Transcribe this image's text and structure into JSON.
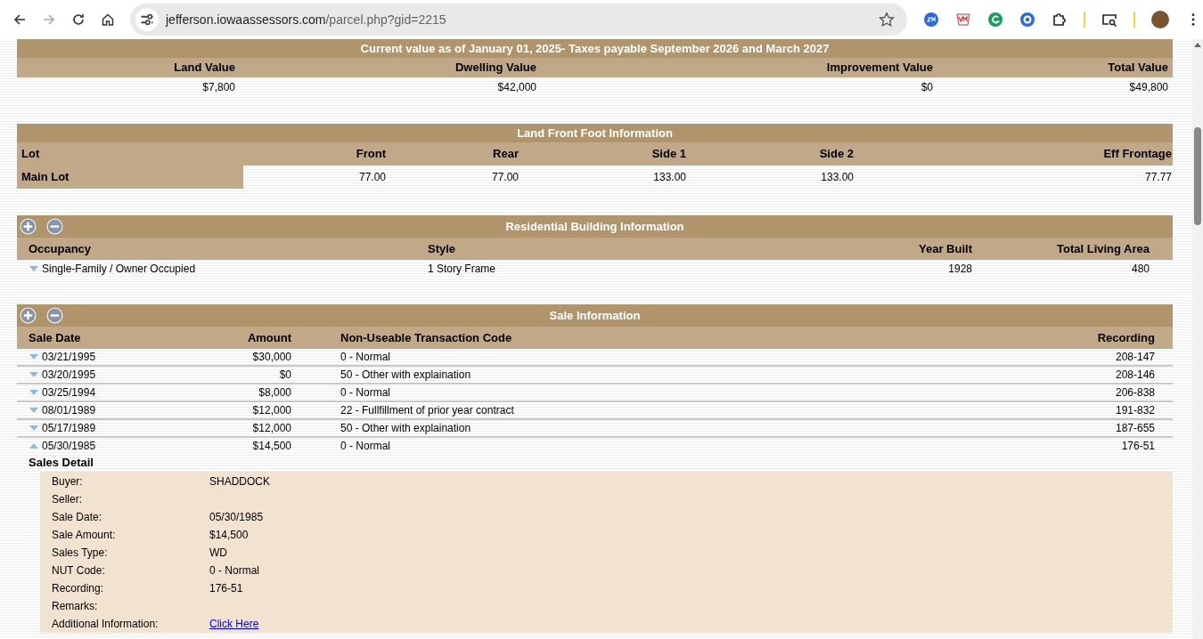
{
  "browser": {
    "url_host": "jefferson.iowaassessors.com",
    "url_path": "/parcel.php?gid=2215",
    "forward_disabled": true
  },
  "current_value": {
    "title": "Current value as of January 01, 2025- Taxes payable September 2026 and March 2027",
    "columns": [
      "Land Value",
      "Dwelling Value",
      "Improvement Value",
      "Total Value"
    ],
    "values": [
      "$7,800",
      "$42,000",
      "$0",
      "$49,800"
    ]
  },
  "land_front_foot": {
    "title": "Land Front Foot Information",
    "columns": [
      "Lot",
      "Front",
      "Rear",
      "Side 1",
      "Side 2",
      "Eff Frontage"
    ],
    "rows": [
      {
        "cells": [
          "Main Lot",
          "77.00",
          "77.00",
          "133.00",
          "133.00",
          "77.77"
        ]
      }
    ]
  },
  "residential": {
    "title": "Residential Building Information",
    "columns": [
      "Occupancy",
      "Style",
      "Year Built",
      "Total Living Area"
    ],
    "rows": [
      {
        "expanded": false,
        "cells": [
          "Single-Family / Owner Occupied",
          "1 Story Frame",
          "1928",
          "480"
        ]
      }
    ]
  },
  "sales": {
    "title": "Sale Information",
    "columns": [
      "Sale Date",
      "Amount",
      "Non-Useable Transaction Code",
      "Recording"
    ],
    "rows": [
      {
        "expanded": false,
        "cells": [
          "03/21/1995",
          "$30,000",
          "0 - Normal",
          "208-147"
        ]
      },
      {
        "expanded": false,
        "cells": [
          "03/20/1995",
          "$0",
          "50 - Other with explaination",
          "208-146"
        ]
      },
      {
        "expanded": false,
        "cells": [
          "03/25/1994",
          "$8,000",
          "0 - Normal",
          "206-838"
        ]
      },
      {
        "expanded": false,
        "cells": [
          "08/01/1989",
          "$12,000",
          "22 - Fullfillment of prior year contract",
          "191-832"
        ]
      },
      {
        "expanded": false,
        "cells": [
          "05/17/1989",
          "$12,000",
          "50 - Other with explaination",
          "187-655"
        ]
      },
      {
        "expanded": true,
        "cells": [
          "05/30/1985",
          "$14,500",
          "0 - Normal",
          "176-51"
        ]
      }
    ],
    "detail": {
      "title": "Sales Detail",
      "fields": [
        {
          "kind": "text",
          "label": "Buyer:",
          "value": "SHADDOCK"
        },
        {
          "label": "Seller:"
        },
        {
          "kind": "text",
          "label": "Sale Date:",
          "value": "05/30/1985"
        },
        {
          "kind": "text",
          "label": "Sale Amount:",
          "value": "$14,500"
        },
        {
          "kind": "text",
          "label": "Sales Type:",
          "value": "WD"
        },
        {
          "kind": "text",
          "label": "NUT Code:",
          "value": "0 - Normal"
        },
        {
          "kind": "text",
          "label": "Recording:",
          "value": "176-51"
        },
        {
          "label": "Remarks:"
        },
        {
          "kind": "link",
          "label": "Additional Information:",
          "value": "Click Here"
        }
      ]
    }
  }
}
